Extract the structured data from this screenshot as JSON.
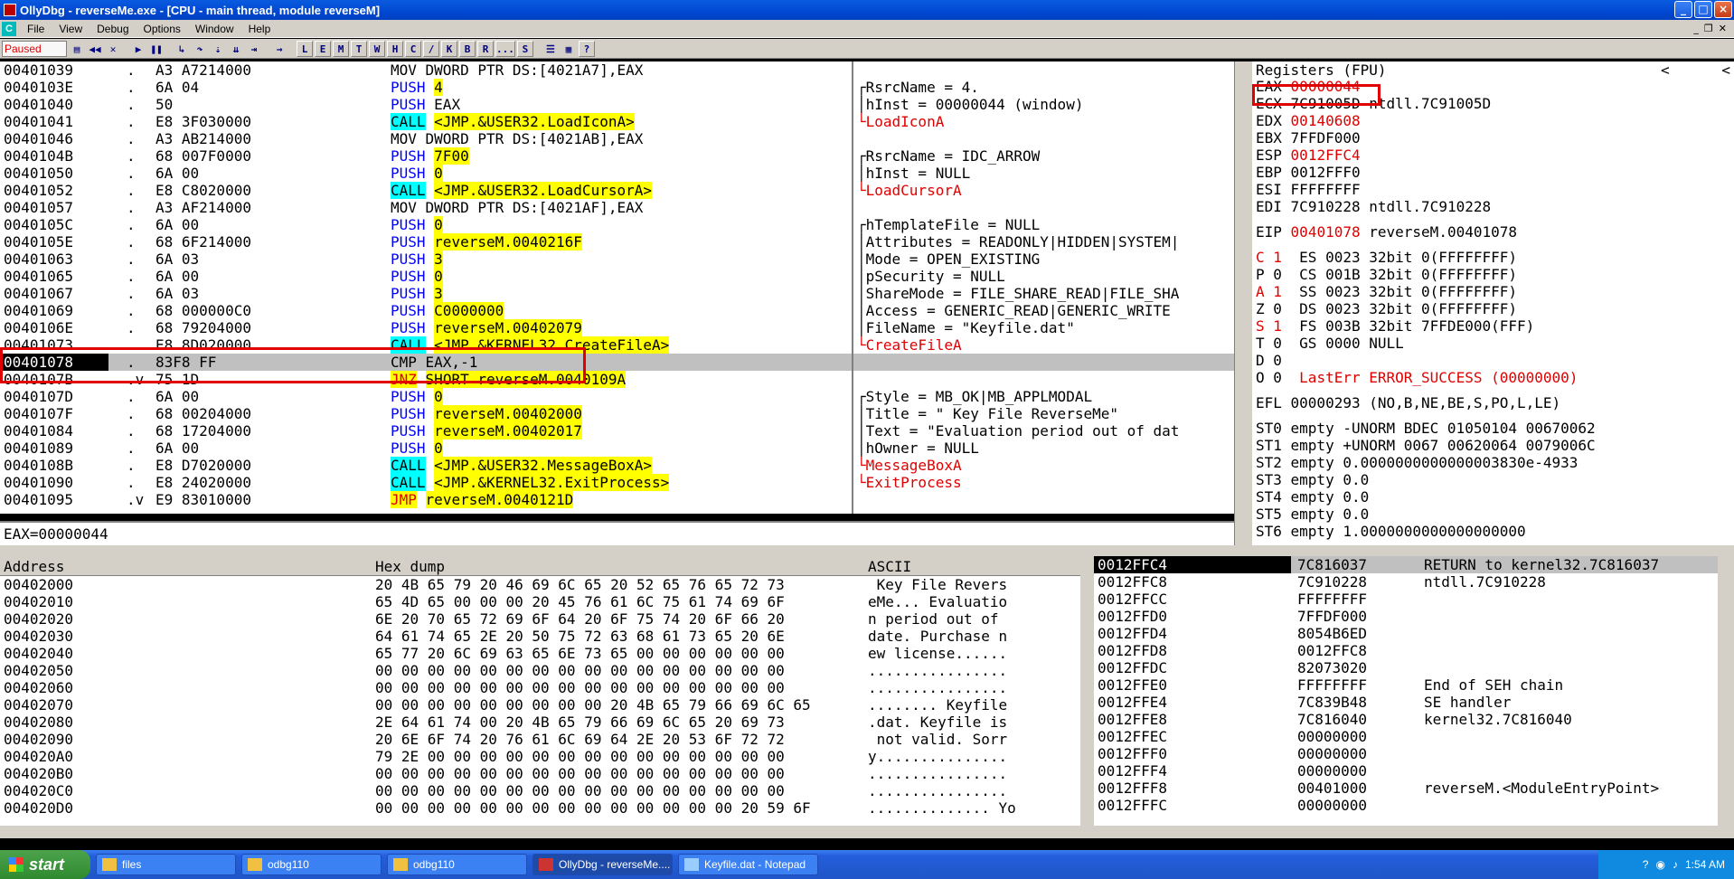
{
  "window": {
    "title": "OllyDbg - reverseMe.exe - [CPU - main thread, module reverseM]"
  },
  "menu": [
    "File",
    "View",
    "Debug",
    "Options",
    "Window",
    "Help"
  ],
  "toolbar": {
    "status": "Paused",
    "letters": [
      "L",
      "E",
      "M",
      "T",
      "W",
      "H",
      "C",
      "/",
      "K",
      "B",
      "R",
      "...",
      "S"
    ]
  },
  "disasm": [
    {
      "addr": "00401039",
      "mark": ".",
      "hex": "A3 A7214000",
      "asm": "MOV DWORD PTR DS:[4021A7],EAX",
      "cmt": ""
    },
    {
      "addr": "0040103E",
      "mark": ".",
      "hex": "6A 04",
      "asm": "PUSH 4",
      "cmt": "┌RsrcName = 4."
    },
    {
      "addr": "00401040",
      "mark": ".",
      "hex": "50",
      "asm": "PUSH EAX",
      "cmt": "│hInst = 00000044 (window)"
    },
    {
      "addr": "00401041",
      "mark": ".",
      "hex": "E8 3F030000",
      "asm": "CALL <JMP.&USER32.LoadIconA>",
      "cmt": "└LoadIconA"
    },
    {
      "addr": "00401046",
      "mark": ".",
      "hex": "A3 AB214000",
      "asm": "MOV DWORD PTR DS:[4021AB],EAX",
      "cmt": ""
    },
    {
      "addr": "0040104B",
      "mark": ".",
      "hex": "68 007F0000",
      "asm": "PUSH 7F00",
      "cmt": "┌RsrcName = IDC_ARROW"
    },
    {
      "addr": "00401050",
      "mark": ".",
      "hex": "6A 00",
      "asm": "PUSH 0",
      "cmt": "│hInst = NULL"
    },
    {
      "addr": "00401052",
      "mark": ".",
      "hex": "E8 C8020000",
      "asm": "CALL <JMP.&USER32.LoadCursorA>",
      "cmt": "└LoadCursorA"
    },
    {
      "addr": "00401057",
      "mark": ".",
      "hex": "A3 AF214000",
      "asm": "MOV DWORD PTR DS:[4021AF],EAX",
      "cmt": ""
    },
    {
      "addr": "0040105C",
      "mark": ".",
      "hex": "6A 00",
      "asm": "PUSH 0",
      "cmt": "┌hTemplateFile = NULL"
    },
    {
      "addr": "0040105E",
      "mark": ".",
      "hex": "68 6F214000",
      "asm": "PUSH reverseM.0040216F",
      "cmt": "│Attributes = READONLY|HIDDEN|SYSTEM|"
    },
    {
      "addr": "00401063",
      "mark": ".",
      "hex": "6A 03",
      "asm": "PUSH 3",
      "cmt": "│Mode = OPEN_EXISTING"
    },
    {
      "addr": "00401065",
      "mark": ".",
      "hex": "6A 00",
      "asm": "PUSH 0",
      "cmt": "│pSecurity = NULL"
    },
    {
      "addr": "00401067",
      "mark": ".",
      "hex": "6A 03",
      "asm": "PUSH 3",
      "cmt": "│ShareMode = FILE_SHARE_READ|FILE_SHA"
    },
    {
      "addr": "00401069",
      "mark": ".",
      "hex": "68 000000C0",
      "asm": "PUSH C0000000",
      "cmt": "│Access = GENERIC_READ|GENERIC_WRITE"
    },
    {
      "addr": "0040106E",
      "mark": ".",
      "hex": "68 79204000",
      "asm": "PUSH reverseM.00402079",
      "cmt": "│FileName = \"Keyfile.dat\""
    },
    {
      "addr": "00401073",
      "mark": ".",
      "hex": "E8 8D020000",
      "asm": "CALL <JMP.&KERNEL32.CreateFileA>",
      "cmt": "└CreateFileA"
    },
    {
      "addr": "00401078",
      "mark": ".",
      "hex": "83F8 FF",
      "asm": "CMP EAX,-1",
      "cmt": ""
    },
    {
      "addr": "0040107B",
      "mark": ".v",
      "hex": "75 1D",
      "asm": "JNZ SHORT reverseM.0040109A",
      "cmt": ""
    },
    {
      "addr": "0040107D",
      "mark": ".",
      "hex": "6A 00",
      "asm": "PUSH 0",
      "cmt": "┌Style = MB_OK|MB_APPLMODAL"
    },
    {
      "addr": "0040107F",
      "mark": ".",
      "hex": "68 00204000",
      "asm": "PUSH reverseM.00402000",
      "cmt": "│Title = \" Key File ReverseMe\""
    },
    {
      "addr": "00401084",
      "mark": ".",
      "hex": "68 17204000",
      "asm": "PUSH reverseM.00402017",
      "cmt": "│Text = \"Evaluation period out of dat"
    },
    {
      "addr": "00401089",
      "mark": ".",
      "hex": "6A 00",
      "asm": "PUSH 0",
      "cmt": "│hOwner = NULL"
    },
    {
      "addr": "0040108B",
      "mark": ".",
      "hex": "E8 D7020000",
      "asm": "CALL <JMP.&USER32.MessageBoxA>",
      "cmt": "└MessageBoxA"
    },
    {
      "addr": "00401090",
      "mark": ".",
      "hex": "E8 24020000",
      "asm": "CALL <JMP.&KERNEL32.ExitProcess>",
      "cmt": "└ExitProcess"
    },
    {
      "addr": "00401095",
      "mark": ".v",
      "hex": "E9 83010000",
      "asm": "JMP reverseM.0040121D",
      "cmt": ""
    }
  ],
  "info_line": "EAX=00000044",
  "registers": {
    "header": "Registers (FPU)",
    "gp": [
      {
        "name": "EAX",
        "val": "00000044",
        "note": ""
      },
      {
        "name": "ECX",
        "val": "7C91005D",
        "note": "ntdll.7C91005D"
      },
      {
        "name": "EDX",
        "val": "00140608",
        "note": ""
      },
      {
        "name": "EBX",
        "val": "7FFDF000",
        "note": ""
      },
      {
        "name": "ESP",
        "val": "0012FFC4",
        "note": ""
      },
      {
        "name": "EBP",
        "val": "0012FFF0",
        "note": ""
      },
      {
        "name": "ESI",
        "val": "FFFFFFFF",
        "note": ""
      },
      {
        "name": "EDI",
        "val": "7C910228",
        "note": "ntdll.7C910228"
      }
    ],
    "eip": {
      "name": "EIP",
      "val": "00401078",
      "note": "reverseM.00401078"
    },
    "flags": [
      "C 1  ES 0023 32bit 0(FFFFFFFF)",
      "P 0  CS 001B 32bit 0(FFFFFFFF)",
      "A 1  SS 0023 32bit 0(FFFFFFFF)",
      "Z 0  DS 0023 32bit 0(FFFFFFFF)",
      "S 1  FS 003B 32bit 7FFDE000(FFF)",
      "T 0  GS 0000 NULL",
      "D 0",
      "O 0  LastErr ERROR_SUCCESS (00000000)"
    ],
    "efl": "EFL 00000293 (NO,B,NE,BE,S,PO,L,LE)",
    "fpu": [
      "ST0 empty -UNORM BDEC 01050104 00670062",
      "ST1 empty +UNORM 0067 00620064 0079006C",
      "ST2 empty 0.0000000000000003830e-4933",
      "ST3 empty 0.0",
      "ST4 empty 0.0",
      "ST5 empty 0.0",
      "ST6 empty 1.0000000000000000000"
    ]
  },
  "dump": {
    "headers": {
      "address": "Address",
      "hex": "Hex dump",
      "ascii": "ASCII"
    },
    "rows": [
      {
        "addr": "00402000",
        "hex": "20 4B 65 79 20 46 69 6C 65 20 52 65 76 65 72 73",
        "ascii": " Key File Revers"
      },
      {
        "addr": "00402010",
        "hex": "65 4D 65 00 00 00 20 45 76 61 6C 75 61 74 69 6F",
        "ascii": "eMe... Evaluatio"
      },
      {
        "addr": "00402020",
        "hex": "6E 20 70 65 72 69 6F 64 20 6F 75 74 20 6F 66 20",
        "ascii": "n period out of "
      },
      {
        "addr": "00402030",
        "hex": "64 61 74 65 2E 20 50 75 72 63 68 61 73 65 20 6E",
        "ascii": "date. Purchase n"
      },
      {
        "addr": "00402040",
        "hex": "65 77 20 6C 69 63 65 6E 73 65 00 00 00 00 00 00",
        "ascii": "ew license......"
      },
      {
        "addr": "00402050",
        "hex": "00 00 00 00 00 00 00 00 00 00 00 00 00 00 00 00",
        "ascii": "................"
      },
      {
        "addr": "00402060",
        "hex": "00 00 00 00 00 00 00 00 00 00 00 00 00 00 00 00",
        "ascii": "................"
      },
      {
        "addr": "00402070",
        "hex": "00 00 00 00 00 00 00 00 00 20 4B 65 79 66 69 6C 65",
        "ascii": "........ Keyfile"
      },
      {
        "addr": "00402080",
        "hex": "2E 64 61 74 00 20 4B 65 79 66 69 6C 65 20 69 73",
        "ascii": ".dat. Keyfile is"
      },
      {
        "addr": "00402090",
        "hex": "20 6E 6F 74 20 76 61 6C 69 64 2E 20 53 6F 72 72",
        "ascii": " not valid. Sorr"
      },
      {
        "addr": "004020A0",
        "hex": "79 2E 00 00 00 00 00 00 00 00 00 00 00 00 00 00",
        "ascii": "y..............."
      },
      {
        "addr": "004020B0",
        "hex": "00 00 00 00 00 00 00 00 00 00 00 00 00 00 00 00",
        "ascii": "................"
      },
      {
        "addr": "004020C0",
        "hex": "00 00 00 00 00 00 00 00 00 00 00 00 00 00 00 00",
        "ascii": "................"
      },
      {
        "addr": "004020D0",
        "hex": "00 00 00 00 00 00 00 00 00 00 00 00 00 00 20 59 6F",
        "ascii": ".............. Yo"
      }
    ]
  },
  "stack": [
    {
      "addr": "0012FFC4",
      "val": "7C816037",
      "cmt": "RETURN to kernel32.7C816037"
    },
    {
      "addr": "0012FFC8",
      "val": "7C910228",
      "cmt": "ntdll.7C910228"
    },
    {
      "addr": "0012FFCC",
      "val": "FFFFFFFF",
      "cmt": ""
    },
    {
      "addr": "0012FFD0",
      "val": "7FFDF000",
      "cmt": ""
    },
    {
      "addr": "0012FFD4",
      "val": "8054B6ED",
      "cmt": ""
    },
    {
      "addr": "0012FFD8",
      "val": "0012FFC8",
      "cmt": ""
    },
    {
      "addr": "0012FFDC",
      "val": "82073020",
      "cmt": ""
    },
    {
      "addr": "0012FFE0",
      "val": "FFFFFFFF",
      "cmt": "End of SEH chain"
    },
    {
      "addr": "0012FFE4",
      "val": "7C839B48",
      "cmt": "SE handler"
    },
    {
      "addr": "0012FFE8",
      "val": "7C816040",
      "cmt": "kernel32.7C816040"
    },
    {
      "addr": "0012FFEC",
      "val": "00000000",
      "cmt": ""
    },
    {
      "addr": "0012FFF0",
      "val": "00000000",
      "cmt": ""
    },
    {
      "addr": "0012FFF4",
      "val": "00000000",
      "cmt": ""
    },
    {
      "addr": "0012FFF8",
      "val": "00401000",
      "cmt": "reverseM.<ModuleEntryPoint>"
    },
    {
      "addr": "0012FFFC",
      "val": "00000000",
      "cmt": ""
    }
  ],
  "taskbar": {
    "start": "start",
    "buttons": [
      "files",
      "odbg110",
      "odbg110",
      "OllyDbg - reverseMe....",
      "Keyfile.dat - Notepad"
    ],
    "clock": "1:54 AM"
  },
  "colors": {
    "accent_red": "#e00000",
    "call_cyan": "#00ffff",
    "arg_yellow": "#ffff00",
    "asm_blue": "#0000ff"
  }
}
